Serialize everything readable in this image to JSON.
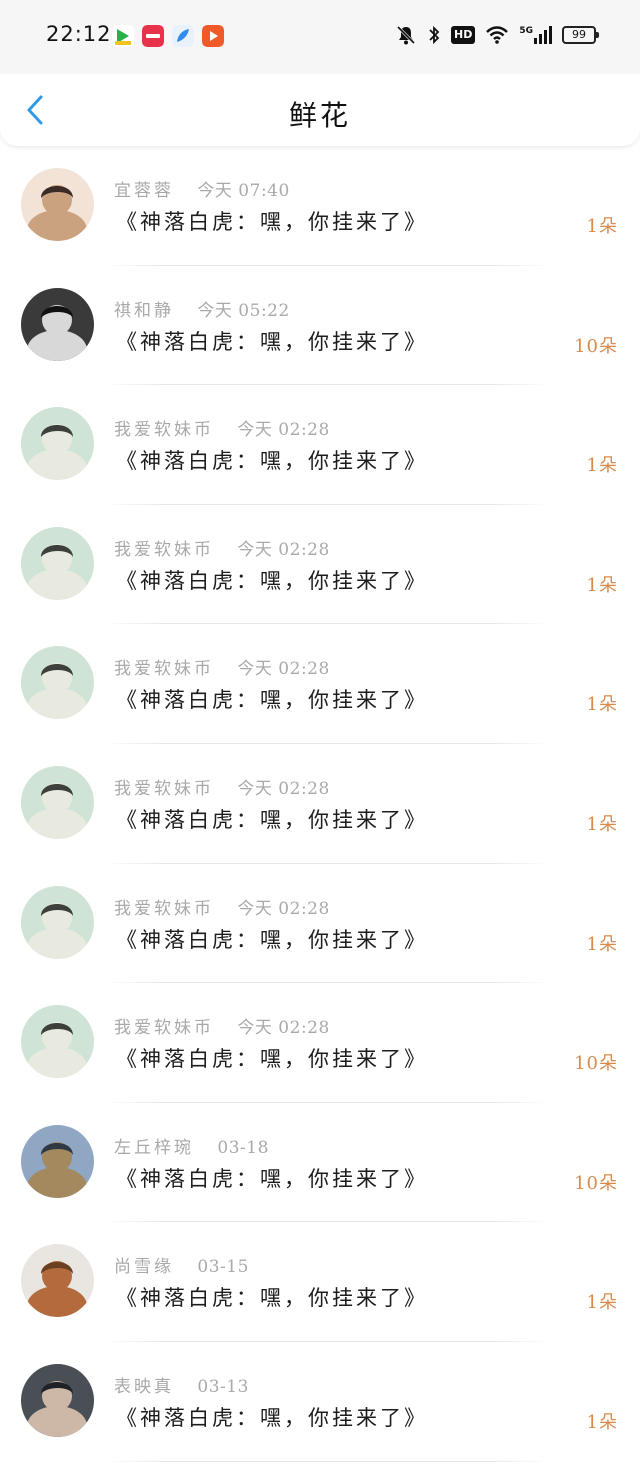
{
  "status_bar": {
    "time": "22:12",
    "hd": "HD",
    "network": "5G",
    "battery": "99",
    "app_icons": [
      {
        "name": "video-app-icon",
        "color": "#27b14a"
      },
      {
        "name": "xiaohongshu-app-icon",
        "color": "#e8314a"
      },
      {
        "name": "feather-app-icon",
        "color": "#2f8cf0"
      },
      {
        "name": "video-player-app-icon",
        "color": "#f05a2a"
      }
    ]
  },
  "header": {
    "title": "鲜花"
  },
  "colors": {
    "accent": "#2f9ae8",
    "count": "#d98a4a",
    "meta": "#a9a9a9"
  },
  "items": [
    {
      "name": "宜蓉蓉",
      "date": "今天 07:40",
      "message": "《神落白虎：嘿，你挂来了》",
      "count": "1朵"
    },
    {
      "name": "祺和静",
      "date": "今天 05:22",
      "message": "《神落白虎：嘿，你挂来了》",
      "count": "10朵"
    },
    {
      "name": "我爱软妹币",
      "date": "今天 02:28",
      "message": "《神落白虎：嘿，你挂来了》",
      "count": "1朵"
    },
    {
      "name": "我爱软妹币",
      "date": "今天 02:28",
      "message": "《神落白虎：嘿，你挂来了》",
      "count": "1朵"
    },
    {
      "name": "我爱软妹币",
      "date": "今天 02:28",
      "message": "《神落白虎：嘿，你挂来了》",
      "count": "1朵"
    },
    {
      "name": "我爱软妹币",
      "date": "今天 02:28",
      "message": "《神落白虎：嘿，你挂来了》",
      "count": "1朵"
    },
    {
      "name": "我爱软妹币",
      "date": "今天 02:28",
      "message": "《神落白虎：嘿，你挂来了》",
      "count": "1朵"
    },
    {
      "name": "我爱软妹币",
      "date": "今天 02:28",
      "message": "《神落白虎：嘿，你挂来了》",
      "count": "10朵"
    },
    {
      "name": "左丘梓琬",
      "date": "03-18",
      "message": "《神落白虎：嘿，你挂来了》",
      "count": "10朵"
    },
    {
      "name": "尚雪缘",
      "date": "03-15",
      "message": "《神落白虎：嘿，你挂来了》",
      "count": "1朵"
    },
    {
      "name": "表映真",
      "date": "03-13",
      "message": "《神落白虎：嘿，你挂来了》",
      "count": "1朵"
    }
  ]
}
